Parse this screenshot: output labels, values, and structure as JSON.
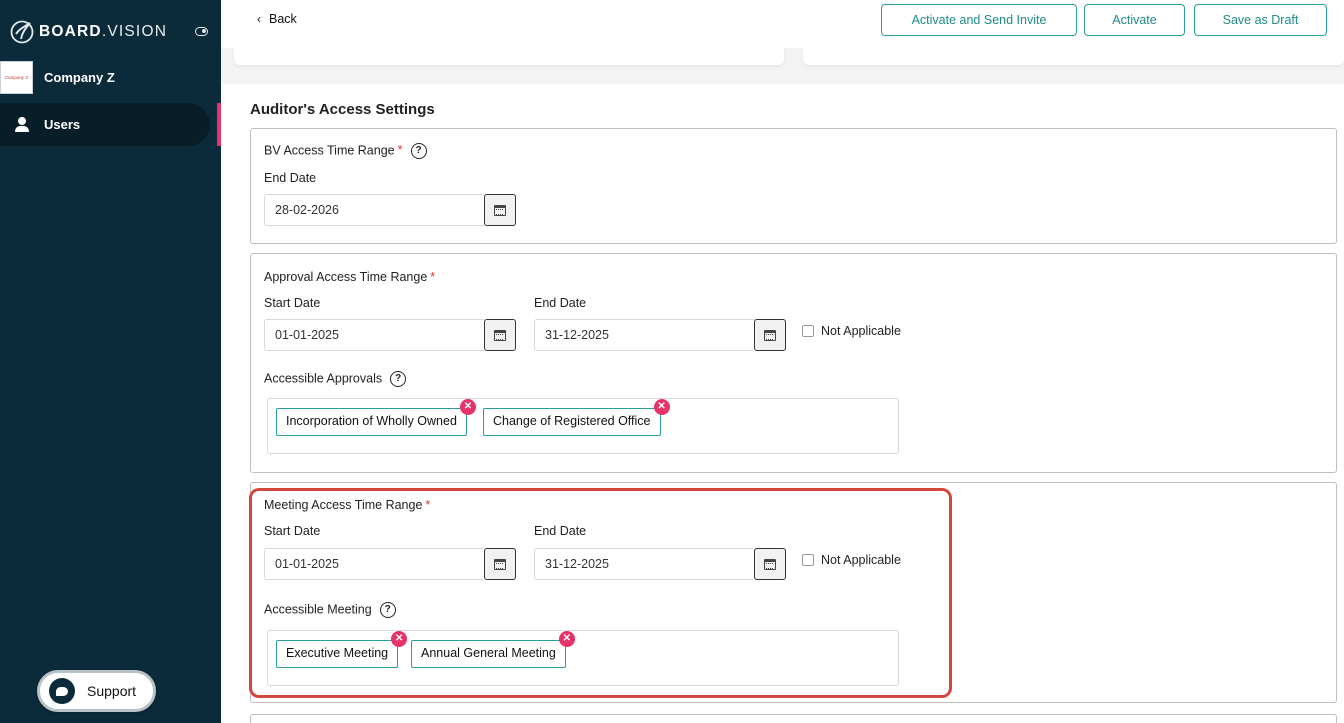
{
  "sidebar": {
    "logo_text_bold": "BOARD",
    "logo_text_rest": ".VISION",
    "company_logo_text": "Company Z",
    "company_name": "Company Z",
    "nav_users": "Users",
    "support": "Support"
  },
  "topbar": {
    "back": "Back",
    "activate_send": "Activate and Send Invite",
    "activate": "Activate",
    "save_draft": "Save as Draft"
  },
  "section_title": "Auditor's Access Settings",
  "bv": {
    "title": "BV Access Time Range",
    "required": "*",
    "end_label": "End Date",
    "end_value": "28-02-2026"
  },
  "approval": {
    "title": "Approval Access Time Range",
    "required": "*",
    "start_label": "Start Date",
    "start_value": "01-01-2025",
    "end_label": "End Date",
    "end_value": "31-12-2025",
    "not_applicable": "Not Applicable",
    "accessible_label": "Accessible Approvals",
    "tags": [
      "Incorporation of Wholly Owned",
      "Change of Registered Office"
    ]
  },
  "meeting": {
    "title": "Meeting Access Time Range",
    "required": "*",
    "start_label": "Start Date",
    "start_value": "01-01-2025",
    "end_label": "End Date",
    "end_value": "31-12-2025",
    "not_applicable": "Not Applicable",
    "accessible_label": "Accessible Meeting",
    "tags": [
      "Executive Meeting",
      "Annual General Meeting"
    ]
  },
  "colors": {
    "sidebar_bg": "#0c2b3a",
    "accent_teal": "#2a9d9b",
    "accent_pink": "#e8336a",
    "highlight_red": "#d2483e"
  }
}
